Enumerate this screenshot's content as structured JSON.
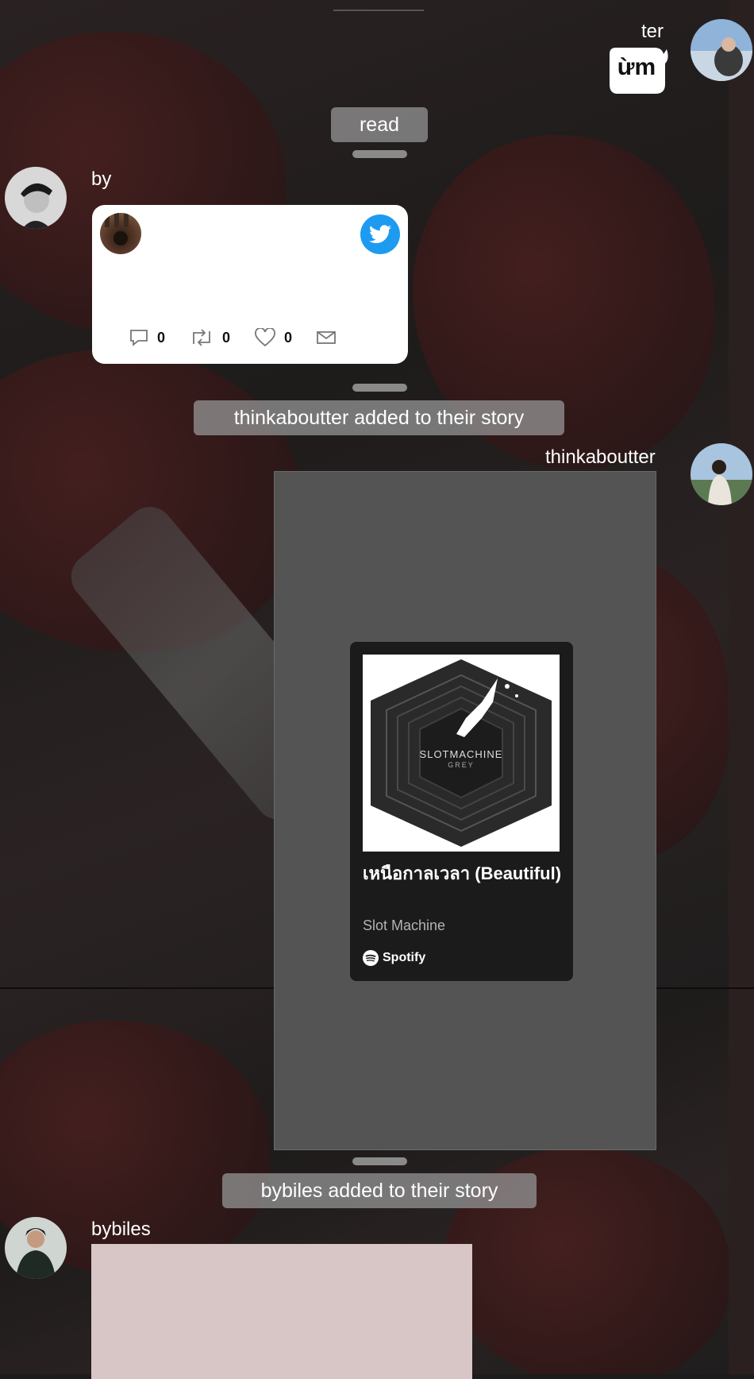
{
  "messages": {
    "ter": {
      "name": "ter",
      "sticker_text": "ừm"
    },
    "read_label": "read",
    "by": {
      "name": "by"
    },
    "tweet": {
      "reply_count": "0",
      "retweet_count": "0",
      "like_count": "0"
    },
    "story1_notice": "thinkaboutter added to their story",
    "thinkaboutter": {
      "name": "thinkaboutter"
    },
    "spotify": {
      "album_text": "SLOTMACHINE",
      "album_sub": "GREY",
      "track_title": "เหนือกาลเวลา (Beautiful)",
      "artist": "Slot Machine",
      "brand": "Spotify"
    },
    "story2_notice": "bybiles added to their story",
    "bybiles": {
      "name": "bybiles"
    }
  },
  "colors": {
    "twitter_blue": "#1d9bf0",
    "spotify_green": "#1db954",
    "pill_bg": "#969696"
  }
}
